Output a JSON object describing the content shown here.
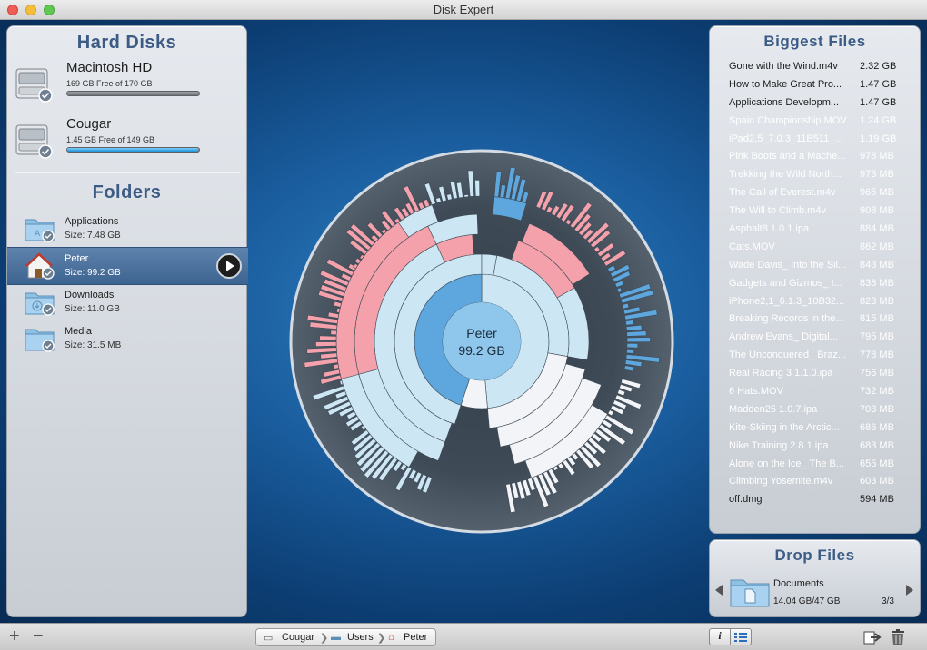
{
  "window": {
    "title": "Disk Expert"
  },
  "hard_disks": {
    "title": "Hard Disks",
    "items": [
      {
        "name": "Macintosh HD",
        "free": "169 GB Free of 170 GB",
        "used_fraction": 0.994
      },
      {
        "name": "Cougar",
        "free": "1.45 GB Free of 149 GB",
        "used_fraction": 0.99
      }
    ]
  },
  "folders": {
    "title": "Folders",
    "items": [
      {
        "name": "Applications",
        "size": "Size: 7.48 GB",
        "icon": "applications-folder-icon"
      },
      {
        "name": "Peter",
        "size": "Size: 99.2 GB",
        "icon": "home-folder-icon",
        "selected": true
      },
      {
        "name": "Downloads",
        "size": "Size: 11.0 GB",
        "icon": "downloads-folder-icon"
      },
      {
        "name": "Media",
        "size": "Size: 31.5 MB",
        "icon": "folder-icon"
      }
    ]
  },
  "chart": {
    "center_name": "Peter",
    "center_size": "99.2 GB"
  },
  "biggest_files": {
    "title": "Biggest Files",
    "items": [
      {
        "name": "Gone with the Wind.m4v",
        "size": "2.32 GB",
        "highlight": false
      },
      {
        "name": "How to Make Great Pro...",
        "size": "1.47 GB",
        "highlight": false
      },
      {
        "name": "Applications Developm...",
        "size": "1.47 GB",
        "highlight": false
      },
      {
        "name": "Spain Championship.MOV",
        "size": "1.24 GB",
        "highlight": true
      },
      {
        "name": "iPad2,5_7.0.3_11B511_...",
        "size": "1.19 GB",
        "highlight": true
      },
      {
        "name": "Pink Boots and a Mache...",
        "size": "978 MB",
        "highlight": true
      },
      {
        "name": "Trekking the Wild North...",
        "size": "973 MB",
        "highlight": true
      },
      {
        "name": "The Call of Everest.m4v",
        "size": "965 MB",
        "highlight": true
      },
      {
        "name": "The Will to Climb.m4v",
        "size": "908 MB",
        "highlight": true
      },
      {
        "name": "Asphalt8 1.0.1.ipa",
        "size": "884 MB",
        "highlight": true
      },
      {
        "name": "Cats.MOV",
        "size": "862 MB",
        "highlight": true
      },
      {
        "name": "Wade Davis_ Into the Sil...",
        "size": "843 MB",
        "highlight": true
      },
      {
        "name": "Gadgets and Gizmos_ I...",
        "size": "838 MB",
        "highlight": true
      },
      {
        "name": "iPhone2,1_6.1.3_10B32...",
        "size": "823 MB",
        "highlight": true
      },
      {
        "name": "Breaking Records in the...",
        "size": "815 MB",
        "highlight": true
      },
      {
        "name": "Andrew Evans_ Digital...",
        "size": "795 MB",
        "highlight": true
      },
      {
        "name": "The Unconquered_ Braz...",
        "size": "778 MB",
        "highlight": true
      },
      {
        "name": "Real Racing 3 1.1.0.ipa",
        "size": "756 MB",
        "highlight": true
      },
      {
        "name": "6 Hats.MOV",
        "size": "732 MB",
        "highlight": true
      },
      {
        "name": "Madden25 1.0.7.ipa",
        "size": "703 MB",
        "highlight": true
      },
      {
        "name": "Kite-Skiing in the Arctic...",
        "size": "686 MB",
        "highlight": true
      },
      {
        "name": "Nike Training 2.8.1.ipa",
        "size": "683 MB",
        "highlight": true
      },
      {
        "name": "Alone on the Ice_ The B...",
        "size": "655 MB",
        "highlight": true
      },
      {
        "name": "Climbing Yosemite.m4v",
        "size": "603 MB",
        "highlight": true
      },
      {
        "name": "off.dmg",
        "size": "594 MB",
        "highlight": false
      }
    ]
  },
  "drop_files": {
    "title": "Drop Files",
    "name": "Documents",
    "size": "14.04 GB/47 GB",
    "count": "3/3"
  },
  "bottom_bar": {
    "add": "+",
    "remove": "−",
    "crumbs": [
      "Cougar",
      "Users",
      "Peter"
    ],
    "info_label": "i"
  },
  "colors": {
    "pink": "#f4a1ab",
    "light_blue": "#cde6f4",
    "mid_blue": "#5ea7de",
    "white": "#f2f4f7",
    "highlight_text": "#ffffff"
  }
}
